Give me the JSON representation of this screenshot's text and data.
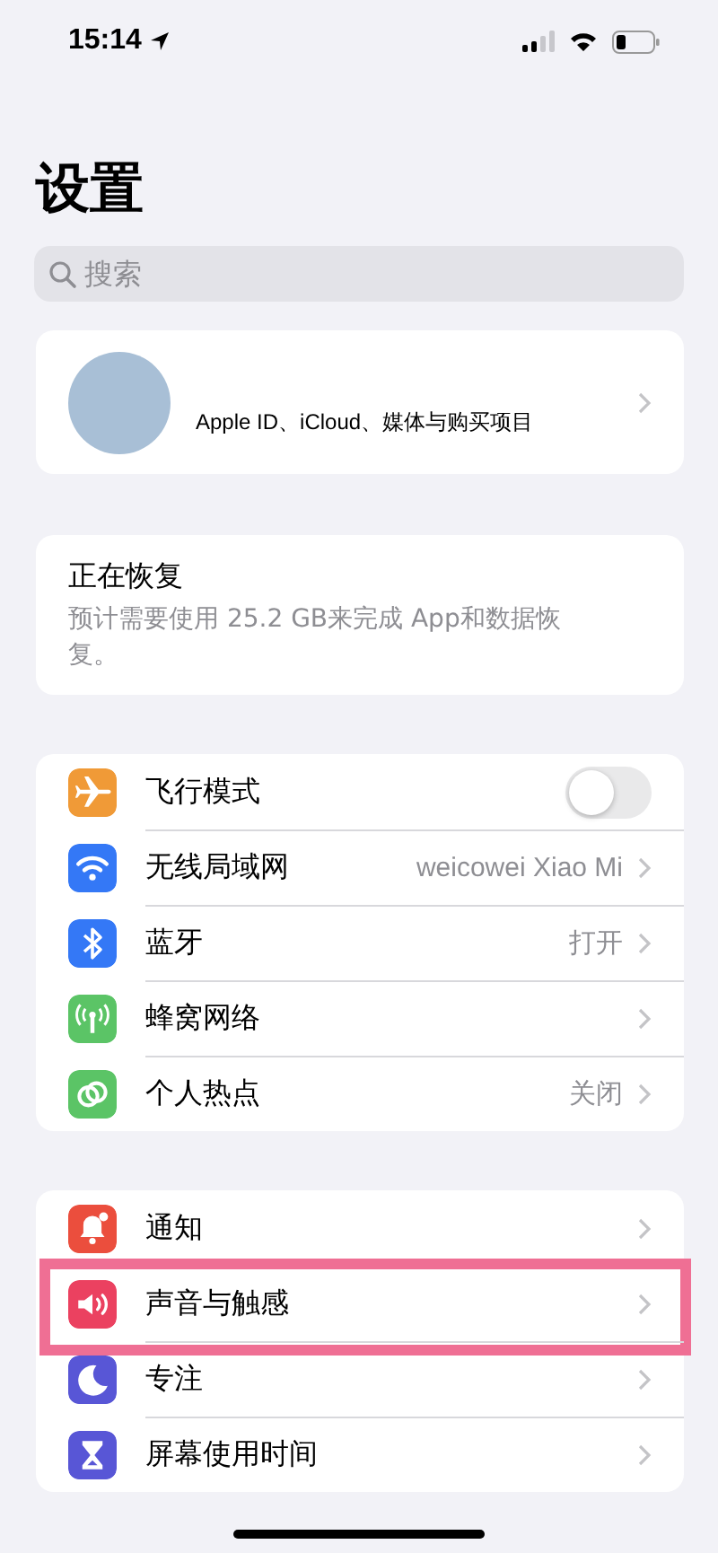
{
  "status_bar": {
    "time": "15:14"
  },
  "title": "设置",
  "search": {
    "placeholder": "搜索"
  },
  "account": {
    "subtitle": "Apple ID、iCloud、媒体与购买项目"
  },
  "restore": {
    "title": "正在恢复",
    "message": "预计需要使用 25.2 GB来完成 App和数据恢复。"
  },
  "groups": [
    {
      "items": [
        {
          "label": "飞行模式",
          "kind": "toggle",
          "on": false,
          "color": "#f09a37",
          "highlighted": false
        },
        {
          "label": "无线局域网",
          "kind": "link",
          "value": "weicowei Xiao Mi",
          "color": "#3478f6",
          "highlighted": false
        },
        {
          "label": "蓝牙",
          "kind": "link",
          "value": "打开",
          "color": "#3478f6",
          "highlighted": false
        },
        {
          "label": "蜂窝网络",
          "kind": "link",
          "color": "#5bc466",
          "highlighted": false
        },
        {
          "label": "个人热点",
          "kind": "link",
          "value": "关闭",
          "color": "#5bc466",
          "highlighted": false
        }
      ]
    },
    {
      "items": [
        {
          "label": "通知",
          "kind": "link",
          "color": "#eb4e3d",
          "highlighted": false
        },
        {
          "label": "声音与触感",
          "kind": "link",
          "color": "#eb4160",
          "highlighted": true
        },
        {
          "label": "专注",
          "kind": "link",
          "color": "#5856d6",
          "highlighted": false
        },
        {
          "label": "屏幕使用时间",
          "kind": "link",
          "color": "#5856d6",
          "highlighted": false
        }
      ]
    }
  ]
}
